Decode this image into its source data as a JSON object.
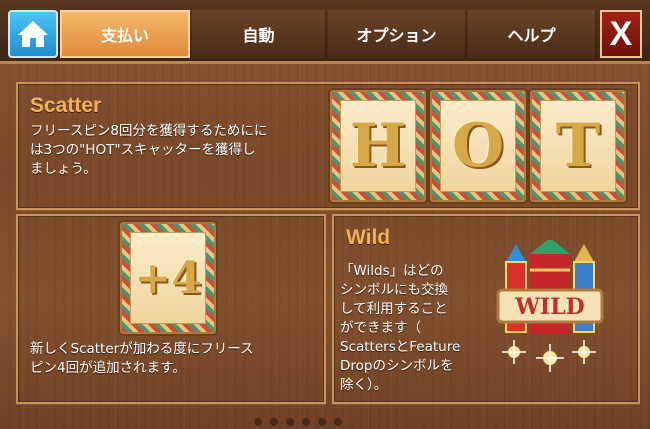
{
  "nav": {
    "home_icon": "home-icon",
    "tabs": [
      {
        "label": "支払い",
        "active": true
      },
      {
        "label": "自動",
        "active": false
      },
      {
        "label": "オプション",
        "active": false
      },
      {
        "label": "ヘルプ",
        "active": false
      }
    ],
    "close_label": "X"
  },
  "scatter": {
    "title": "Scatter",
    "lines": [
      "フリースピン8回分を獲得するためにに",
      "は3つの\"HOT\"スキャッターを獲得し",
      "ましょう。"
    ],
    "symbols": [
      "H",
      "O",
      "T"
    ]
  },
  "plus": {
    "symbol": "+4",
    "lines": [
      "新しくScatterが加わる度にフリース",
      "ピン4回が追加されます。"
    ]
  },
  "wild": {
    "title": "Wild",
    "symbol_text": "WILD",
    "lines": [
      "「Wilds」はどの",
      "シンボルにも交換",
      "して利用すること",
      "ができます（",
      "ScattersとFeature",
      "Dropのシンボルを",
      "除く）。"
    ]
  },
  "colors": {
    "accent_title": "#f2b25a",
    "home_blue": "#1f8fd0",
    "close_red": "#8f1b10",
    "active_tab": "#e08a3a"
  },
  "pagination": {
    "count": 6,
    "active_index": 0
  }
}
